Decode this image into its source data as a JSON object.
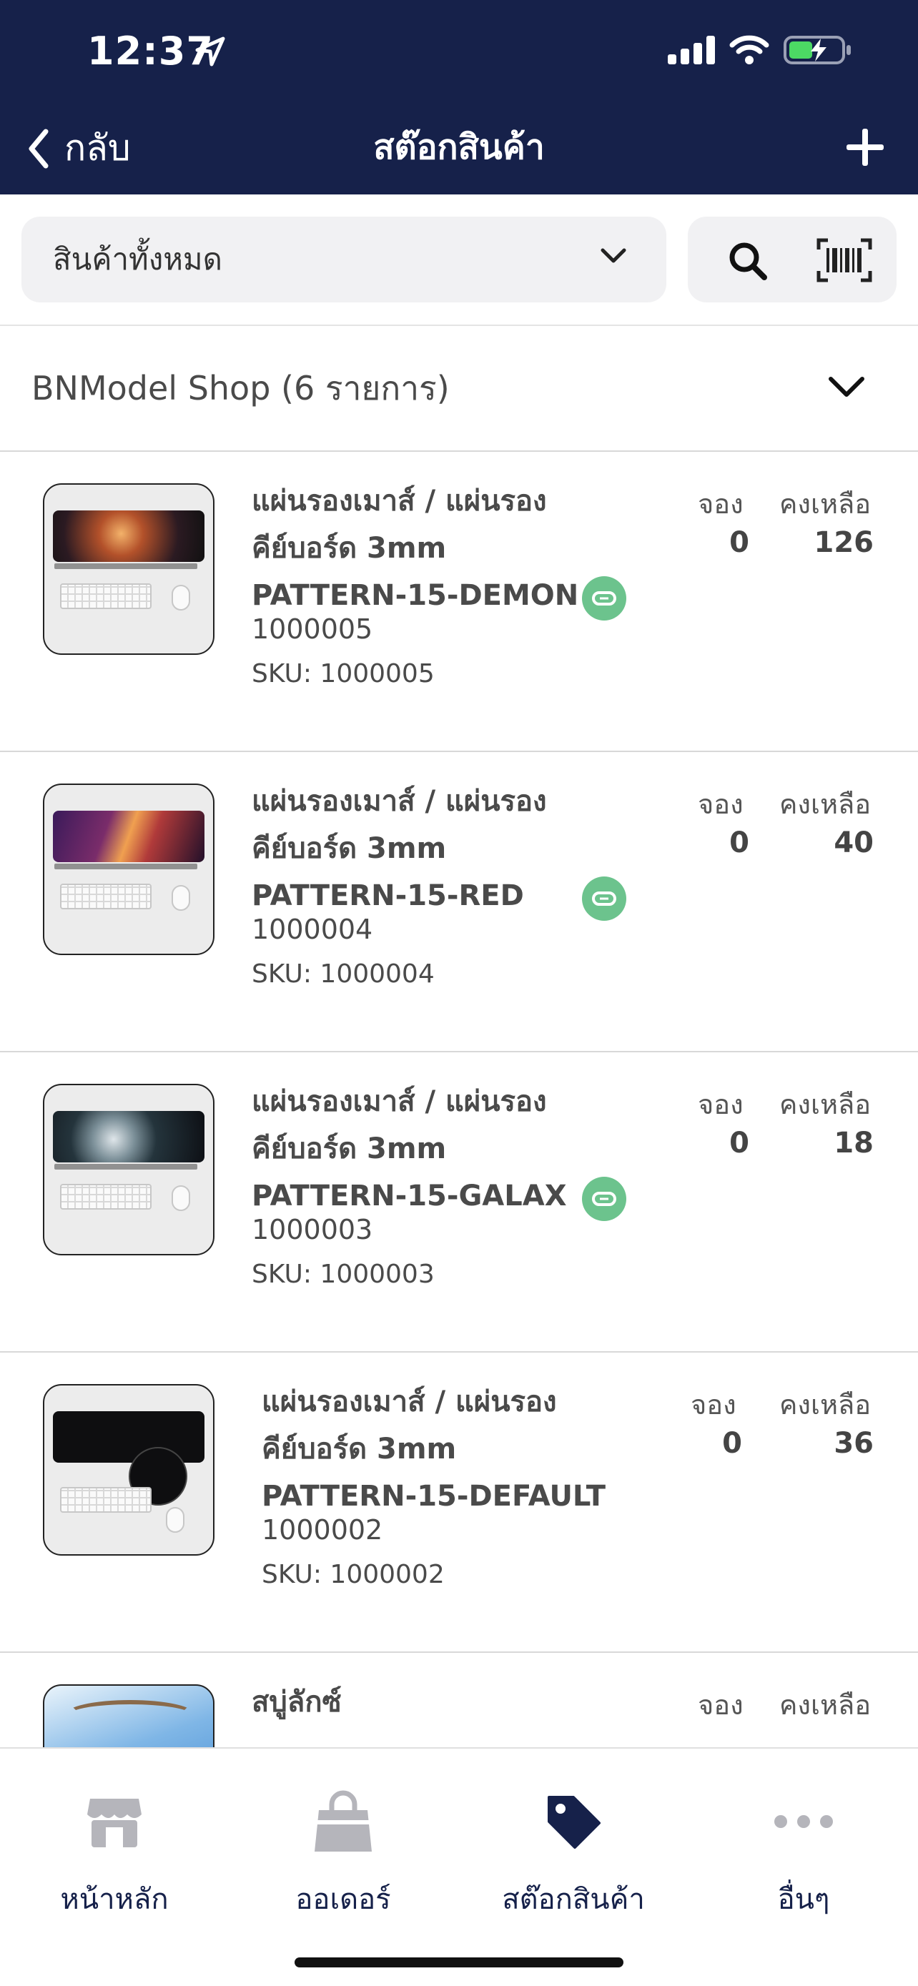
{
  "status_bar": {
    "time": "12:37"
  },
  "nav": {
    "back_label": "กลับ",
    "title": "สต๊อกสินค้า"
  },
  "filter": {
    "category_value": "สินค้าทั้งหมด"
  },
  "shop": {
    "header": "BNModel Shop (6 รายการ)"
  },
  "columns": {
    "reserved": "จอง",
    "remaining": "คงเหลือ"
  },
  "products": [
    {
      "name_line1": "แผ่นรองเมาส์  / แผ่นรอง",
      "name_line2": "คีย์บอร์ด 3mm",
      "name_line3": "PATTERN-15-DEMON",
      "code": "1000005",
      "sku": "SKU: 1000005",
      "reserved": "0",
      "remaining": "126",
      "linked": true
    },
    {
      "name_line1": "แผ่นรองเมาส์  / แผ่นรอง",
      "name_line2": "คีย์บอร์ด 3mm",
      "name_line3": "PATTERN-15-RED",
      "code": "1000004",
      "sku": "SKU: 1000004",
      "reserved": "0",
      "remaining": "40",
      "linked": true
    },
    {
      "name_line1": "แผ่นรองเมาส์  / แผ่นรอง",
      "name_line2": "คีย์บอร์ด 3mm",
      "name_line3": "PATTERN-15-GALAX",
      "code": "1000003",
      "sku": "SKU: 1000003",
      "reserved": "0",
      "remaining": "18",
      "linked": true
    },
    {
      "name_line1": "แผ่นรองเมาส์  / แผ่นรอง",
      "name_line2": "คีย์บอร์ด 3mm",
      "name_line3": "PATTERN-15-DEFAULT",
      "code": "1000002",
      "sku": "SKU: 1000002",
      "reserved": "0",
      "remaining": "36",
      "linked": false
    },
    {
      "name_line1": "สบู่ลักซ์",
      "name_line2": "",
      "name_line3": "",
      "code": "",
      "sku": "",
      "reserved": "",
      "remaining": "",
      "linked": false
    }
  ],
  "tabs": [
    {
      "label": "หน้าหลัก",
      "icon": "store-icon"
    },
    {
      "label": "ออเดอร์",
      "icon": "shopping-bag-icon"
    },
    {
      "label": "สต๊อกสินค้า",
      "icon": "tag-icon",
      "active": true
    },
    {
      "label": "อื่นๆ",
      "icon": "more-icon"
    }
  ],
  "colors": {
    "header_bg": "#16214a",
    "link_badge": "#6cc38d",
    "inactive_tab_icon": "#b5b5bb",
    "active_tab_icon": "#16214a"
  }
}
